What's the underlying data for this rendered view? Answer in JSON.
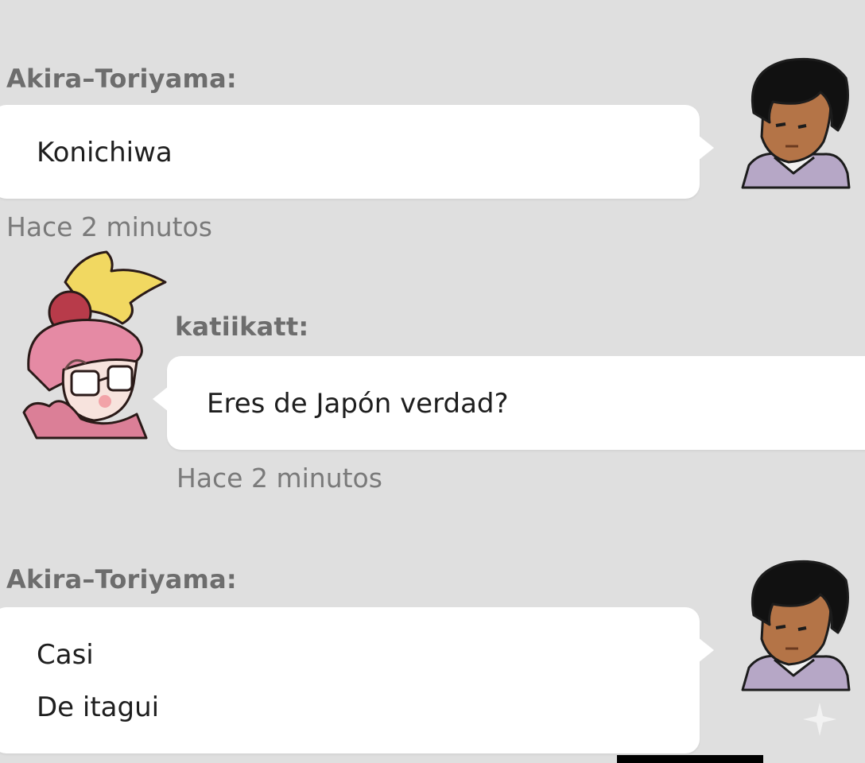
{
  "messages": [
    {
      "username": "Akira–Toriyama:",
      "lines": [
        "Konichiwa"
      ],
      "timestamp": "Hace 2 minutos",
      "avatar": "boy-avatar-icon"
    },
    {
      "username": "katiikatt:",
      "lines": [
        "Eres de Japón verdad?"
      ],
      "timestamp": "Hace 2 minutos",
      "avatar": "girl-pink-hat-avatar-icon"
    },
    {
      "username": "Akira–Toriyama:",
      "lines": [
        "Casi",
        "De itagui"
      ],
      "avatar": "boy-avatar-icon"
    }
  ],
  "colors": {
    "background": "#dfdfdf",
    "bubble": "#ffffff",
    "username": "#6d6d6d",
    "timestamp": "#7a7a7a",
    "message_text": "#1e1e1e"
  }
}
